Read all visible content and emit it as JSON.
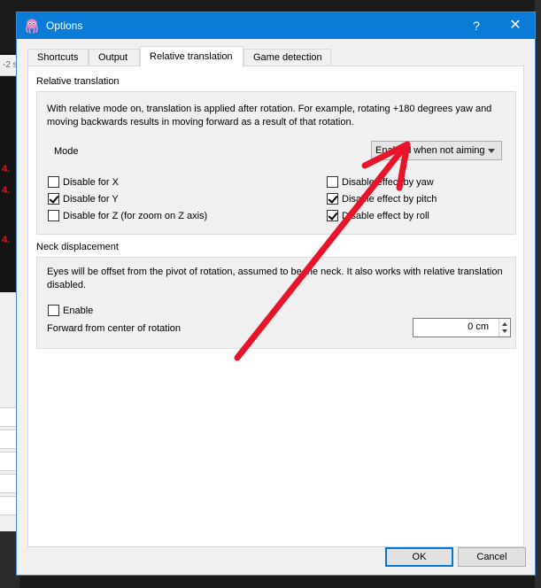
{
  "window": {
    "title": "Options",
    "help_label": "?",
    "close_label": "✕",
    "app_icon": "octopus-app-icon"
  },
  "background": {
    "top_fragment": "-2 s",
    "red_markers": [
      "4.",
      "4.",
      "4."
    ]
  },
  "tabs": [
    {
      "label": "Shortcuts",
      "active": false
    },
    {
      "label": "Output",
      "active": false
    },
    {
      "label": "Relative translation",
      "active": true
    },
    {
      "label": "Game detection",
      "active": false
    }
  ],
  "relative_translation": {
    "section_label": "Relative translation",
    "description": "With relative mode on, translation is applied after rotation. For example, rotating +180 degrees yaw and moving backwards results in moving forward as a result of that rotation.",
    "mode_label": "Mode",
    "mode_value": "Enabled when not aiming",
    "left_options": [
      {
        "label": "Disable for X",
        "checked": false
      },
      {
        "label": "Disable for Y",
        "checked": true
      },
      {
        "label": "Disable for Z (for zoom on Z axis)",
        "checked": false
      }
    ],
    "right_options": [
      {
        "label": "Disable effect by yaw",
        "checked": false
      },
      {
        "label": "Disable effect by pitch",
        "checked": true
      },
      {
        "label": "Disable effect by roll",
        "checked": true
      }
    ]
  },
  "neck_displacement": {
    "section_label": "Neck displacement",
    "description": "Eyes will be offset from the pivot of rotation, assumed to be the neck. It also works with relative translation disabled.",
    "enable_label": "Enable",
    "enable_checked": false,
    "forward_label": "Forward from center of rotation",
    "forward_value": "0 cm"
  },
  "buttons": {
    "ok": "OK",
    "cancel": "Cancel"
  },
  "annotation_color": "#e8142a"
}
